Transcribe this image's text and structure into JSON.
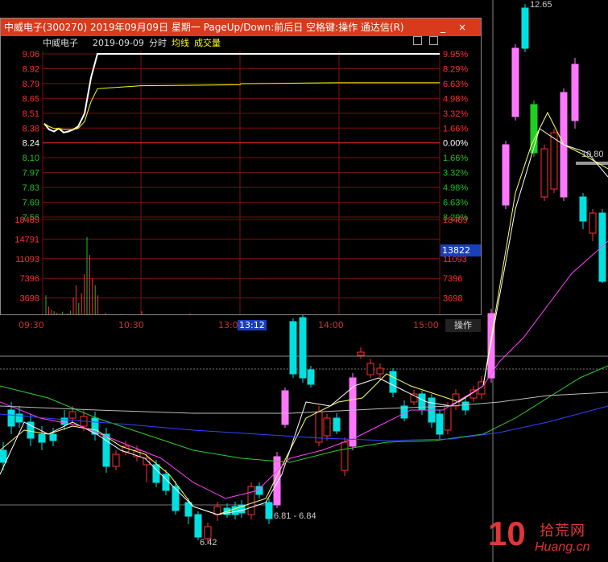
{
  "popup": {
    "title": "中威电子(300270) 2019年09月09日 星期一 PageUp/Down:前后日 空格键:操作 通达信(R)",
    "min_label": "_",
    "close_label": "×",
    "header_name": "中威电子",
    "header_date": "2019-09-09",
    "header_type": "分时",
    "header_avg": "均线",
    "header_vol": "成交量",
    "price_ticks": [
      "9.06",
      "8.92",
      "8.79",
      "8.65",
      "8.51",
      "8.38",
      "8.24",
      "8.10",
      "7.97",
      "7.83",
      "7.69",
      "7.56"
    ],
    "pct_ticks": [
      "9.95%",
      "8.29%",
      "6.63%",
      "4.98%",
      "3.32%",
      "1.66%",
      "0.00%",
      "1.66%",
      "3.32%",
      "4.98%",
      "6.63%",
      "8.29%"
    ],
    "vol_ticks": [
      "18489",
      "14791",
      "11093",
      "7396",
      "3698"
    ],
    "vol_right_ticks": [
      "18489",
      "13822",
      "11093",
      "7396",
      "3698"
    ],
    "time_labels": [
      "09:30",
      "10:30",
      "13:01",
      "13:12",
      "14:00",
      "15:00"
    ],
    "op_button": "操作",
    "colors": {
      "up": "#ff3030",
      "down": "#20c020",
      "neutral": "#ffffff",
      "avg": "#ffff00",
      "grid": "#7a1010"
    }
  },
  "annotations": {
    "top_price": "12.65",
    "right_price": "10.80",
    "low_price": "6.42",
    "range_label": "6.81 - 6.84"
  },
  "logo": {
    "number": "10",
    "cn": "拾荒网",
    "site": "Huang.cn"
  },
  "chart_data": {
    "type": "line",
    "title": "中威电子 2019-09-09 分时",
    "x": [
      "09:30",
      "09:35",
      "09:40",
      "09:45",
      "09:50",
      "09:55",
      "10:00",
      "10:05",
      "10:10",
      "10:15",
      "10:30",
      "11:00",
      "11:30",
      "13:00",
      "14:00",
      "15:00"
    ],
    "series": [
      {
        "name": "price",
        "values": [
          8.36,
          8.3,
          8.28,
          8.31,
          8.27,
          8.28,
          8.3,
          8.33,
          8.46,
          8.82,
          9.06,
          9.06,
          9.06,
          9.06,
          9.06,
          9.06
        ]
      },
      {
        "name": "均线",
        "values": [
          8.36,
          8.33,
          8.31,
          8.31,
          8.3,
          8.3,
          8.3,
          8.31,
          8.38,
          8.58,
          8.71,
          8.74,
          8.75,
          8.76,
          8.77,
          8.77
        ]
      }
    ],
    "volume_ylim": [
      0,
      18489
    ],
    "ylim": [
      7.42,
      9.06
    ]
  }
}
